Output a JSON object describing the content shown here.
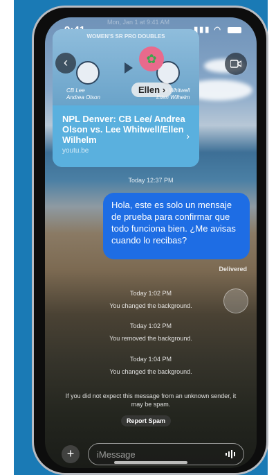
{
  "status_bar": {
    "time": "9:41",
    "ghost_date": "Mon, Jan 1 at 9:41 AM",
    "signal": "signal-icon",
    "wifi": "wifi-icon",
    "battery": "battery-icon"
  },
  "header": {
    "back_icon": "chevron-left-icon",
    "contact_name": "Ellen",
    "video_icon": "video-camera-icon"
  },
  "link_card": {
    "banner": "WOMEN'S SR PRO DOUBLES",
    "team_left": [
      "CB Lee",
      "Andrea Olson"
    ],
    "team_right": [
      "Lee Whitwell",
      "Ellen Wilhelm"
    ],
    "title": "NPL Denver: CB Lee/ Andrea Olson vs. Lee Whitwell/Ellen Wilhelm",
    "url": "youtu.be"
  },
  "timestamp_top": "Today 12:37 PM",
  "message": {
    "text": "Hola, este es solo un mensaje de prueba para confirmar que todo funciona bien. ¿Me avisas cuando lo recibas?",
    "status": "Delivered"
  },
  "events": [
    {
      "time": "Today 1:02 PM",
      "text": "You changed the background."
    },
    {
      "time": "Today 1:02 PM",
      "text": "You removed the background."
    },
    {
      "time": "Today 1:04 PM",
      "text": "You changed the background."
    }
  ],
  "spam_warning": "If you did not expect this message from an unknown sender, it may be spam.",
  "report_spam": "Report Spam",
  "composer": {
    "placeholder": "iMessage",
    "plus_icon": "plus-icon",
    "audio_icon": "waveform-icon"
  },
  "colors": {
    "page_background": "#1a7ab5",
    "sent_bubble": "#1e6de4",
    "link_card": "#5ab0de"
  }
}
